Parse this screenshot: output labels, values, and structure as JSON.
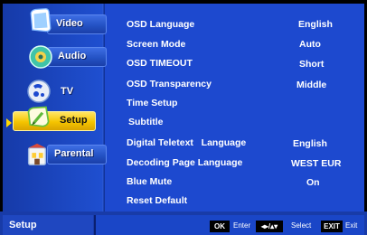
{
  "sidebar": {
    "items": [
      {
        "label": "Video",
        "icon": "video-icon"
      },
      {
        "label": "Audio",
        "icon": "audio-icon"
      },
      {
        "label": "TV",
        "icon": "tv-icon"
      },
      {
        "label": "Setup",
        "icon": "setup-icon",
        "selected": true
      },
      {
        "label": "Parental",
        "icon": "parental-icon"
      }
    ]
  },
  "settings": {
    "rows": [
      {
        "label": "OSD Language",
        "value": "English"
      },
      {
        "label": "Screen Mode",
        "value": "Auto"
      },
      {
        "label": "OSD TIMEOUT",
        "value": "Short"
      },
      {
        "label": "OSD Transparency",
        "value": "Middle"
      },
      {
        "label": "Time Setup",
        "value": ""
      },
      {
        "label": "Subtitle",
        "value": ""
      },
      {
        "label": "Digital Teletext   Language",
        "value": "English"
      },
      {
        "label": "Decoding Page Language",
        "value": "WEST EUR"
      },
      {
        "label": "Blue Mute",
        "value": "On"
      },
      {
        "label": "Reset Default",
        "value": ""
      }
    ]
  },
  "footer": {
    "title": "Setup",
    "ok_key": "OK",
    "enter_caption": "Enter",
    "nav_key": "◂▸/▴▾",
    "select_caption": "Select",
    "exit_key": "EXIT",
    "exit_caption": "Exit"
  },
  "colors": {
    "background": "#1d49cf",
    "selected": "#f5c400"
  }
}
